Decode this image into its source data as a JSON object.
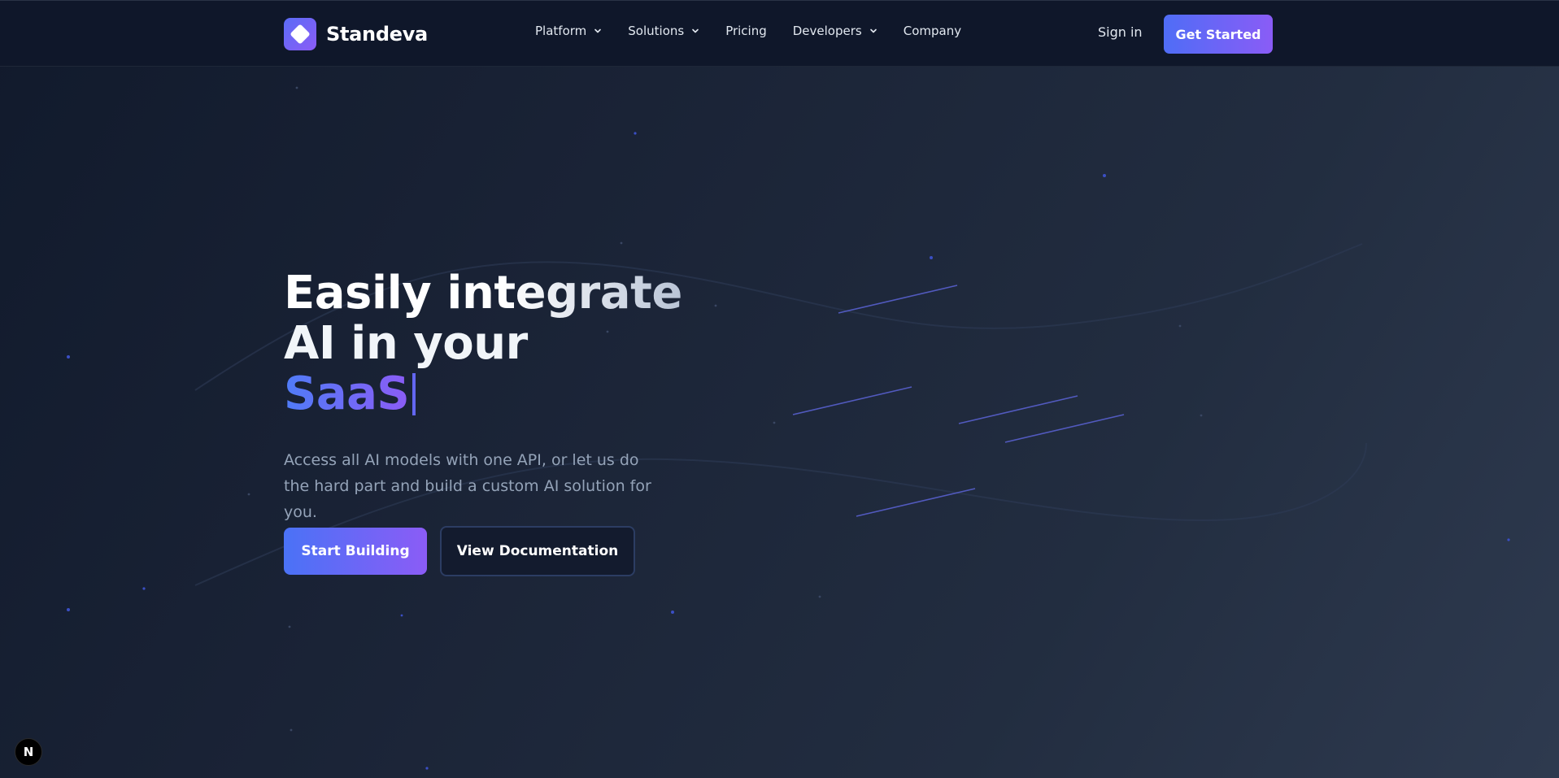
{
  "brand": {
    "name": "Standeva",
    "logo_icon": "diamond-icon"
  },
  "nav": {
    "items": [
      {
        "label": "Platform",
        "has_dropdown": true
      },
      {
        "label": "Solutions",
        "has_dropdown": true
      },
      {
        "label": "Pricing",
        "has_dropdown": false
      },
      {
        "label": "Developers",
        "has_dropdown": true
      },
      {
        "label": "Company",
        "has_dropdown": false
      }
    ],
    "sign_in": "Sign in",
    "cta": "Get Started"
  },
  "hero": {
    "title_line1": "Easily integrate",
    "title_line2": "AI in your",
    "title_accent": "SaaS",
    "subtitle": "Access all AI models with one API, or let us do the hard part and build a custom AI solution for you.",
    "primary_button": "Start Building",
    "secondary_button": "View Documentation"
  },
  "badge": {
    "label": "N"
  },
  "colors": {
    "accent_start": "#4f6df6",
    "accent_end": "#8b5cf6",
    "nav_bg": "#0f172a",
    "background": "#1a2336"
  }
}
